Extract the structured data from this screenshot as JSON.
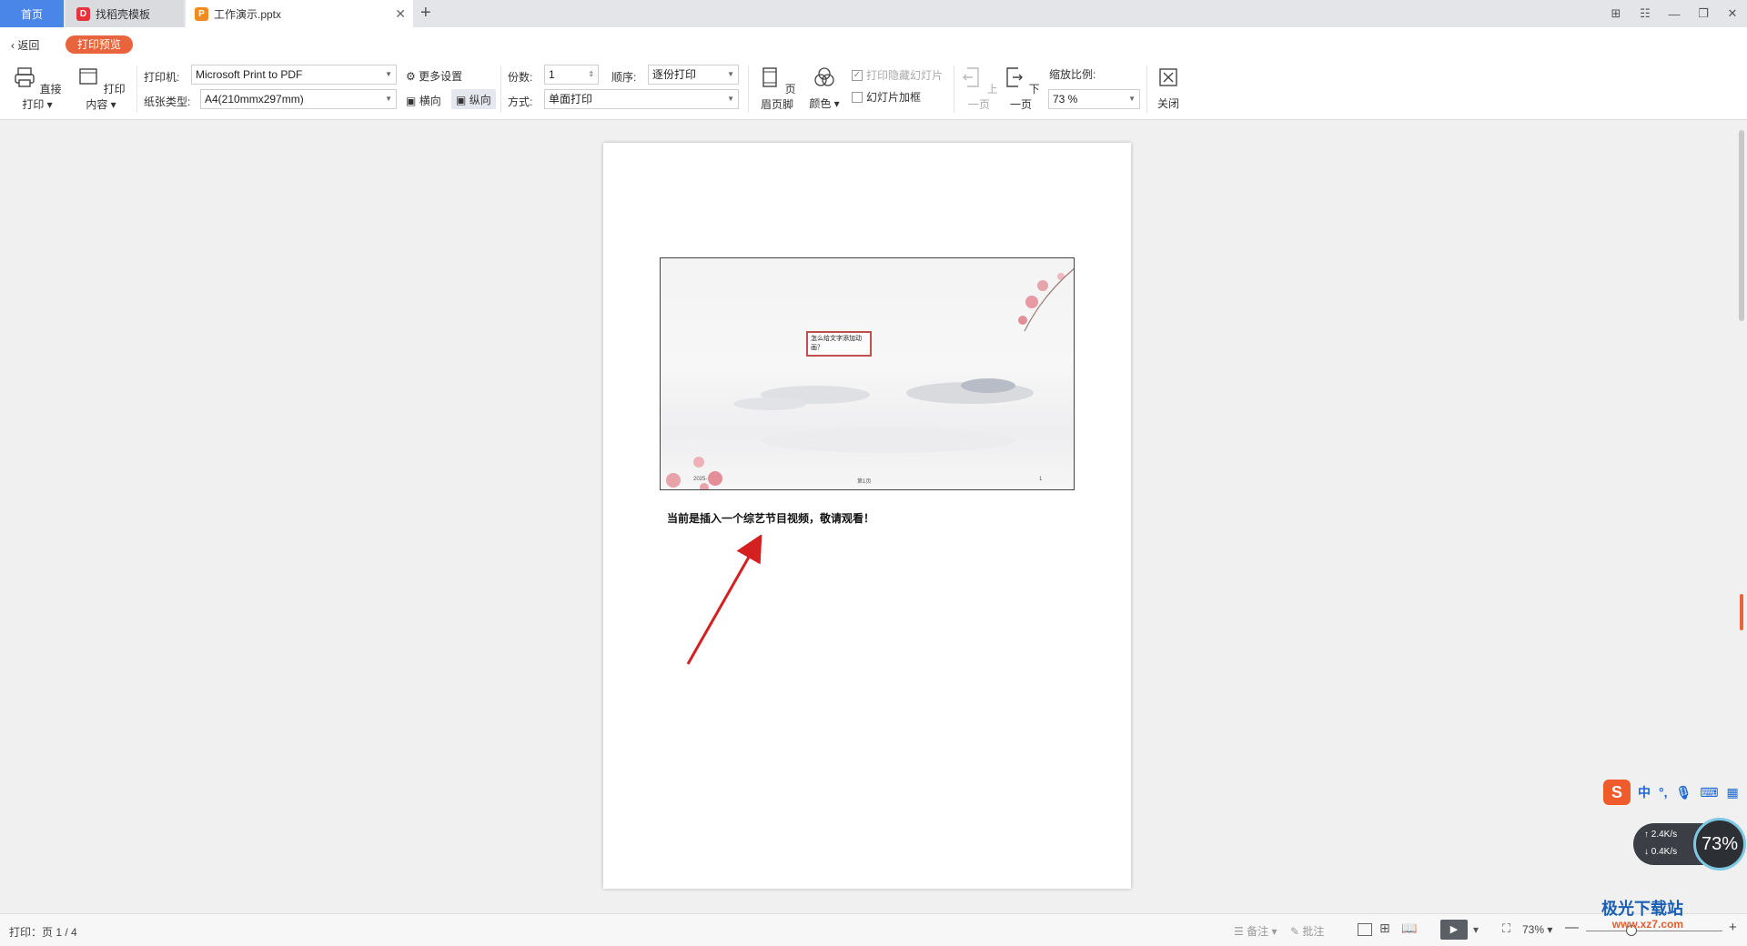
{
  "tabs": {
    "home": "首页",
    "template": "找稻壳模板",
    "document": "工作演示.pptx"
  },
  "window_controls": [
    "⊞",
    "☷",
    "—",
    "❐",
    "✕"
  ],
  "toolbar": {
    "back": "返回",
    "mode": "打印预览",
    "direct_print": "直接打印",
    "print_content": "打印内容",
    "printer_label": "打印机:",
    "printer_value": "Microsoft Print to PDF",
    "more_settings": "更多设置",
    "paper_label": "纸张类型:",
    "paper_value": "A4(210mmx297mm)",
    "landscape": "横向",
    "portrait": "纵向",
    "copies_label": "份数:",
    "copies_value": "1",
    "order_label": "顺序:",
    "order_value": "逐份打印",
    "method_label": "方式:",
    "method_value": "单面打印",
    "header_footer": "页眉页脚",
    "color": "颜色",
    "print_hidden": "打印隐藏幻灯片",
    "slide_frame": "幻灯片加框",
    "prev_page": "上一页",
    "next_page": "下一页",
    "zoom_label": "缩放比例:",
    "zoom_value": "73 %",
    "close": "关闭"
  },
  "page": {
    "slide_title": "怎么给文字添加动画？",
    "slide_date": "2025-",
    "slide_page": "第1页",
    "slide_number": "1",
    "caption": "当前是插入一个综艺节目视频，敬请观看！"
  },
  "ime": {
    "logo": "S",
    "mode": "中"
  },
  "net": {
    "up": "↑ 2.4K/s",
    "down": "↓ 0.4K/s",
    "percent": "73%"
  },
  "statusbar": {
    "print_info": "打印：页 1 / 4",
    "notes": "备注",
    "comments": "批注",
    "zoom": "73%"
  },
  "watermark": {
    "title": "极光下载站",
    "url": "www.xz7.com"
  },
  "colors": {
    "accent": "#e8643c",
    "tab_active": "#4a86e8",
    "arrow": "#d42020"
  }
}
